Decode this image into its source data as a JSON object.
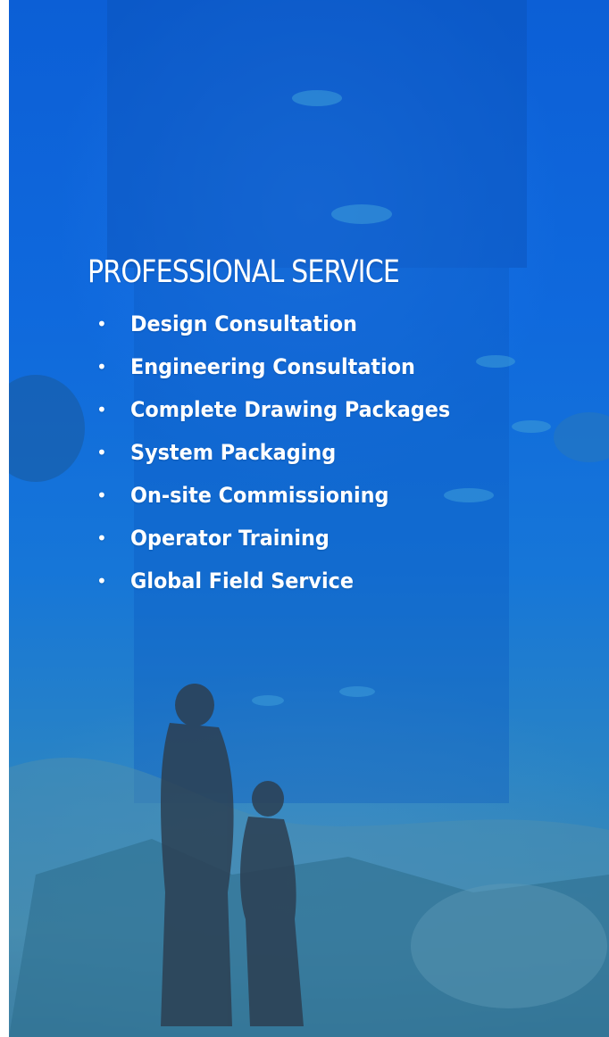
{
  "title": "PROFESSIONAL SERVICE",
  "services": [
    "Design Consultation",
    "Engineering Consultation",
    "Complete Drawing Packages",
    "System Packaging",
    "On-site Commissioning",
    "Operator Training",
    "Global Field Service"
  ],
  "bullet_glyph": "•",
  "colors": {
    "background_top": "#0c5fd6",
    "background_bottom": "#2d6e93",
    "text": "#ffffff"
  }
}
